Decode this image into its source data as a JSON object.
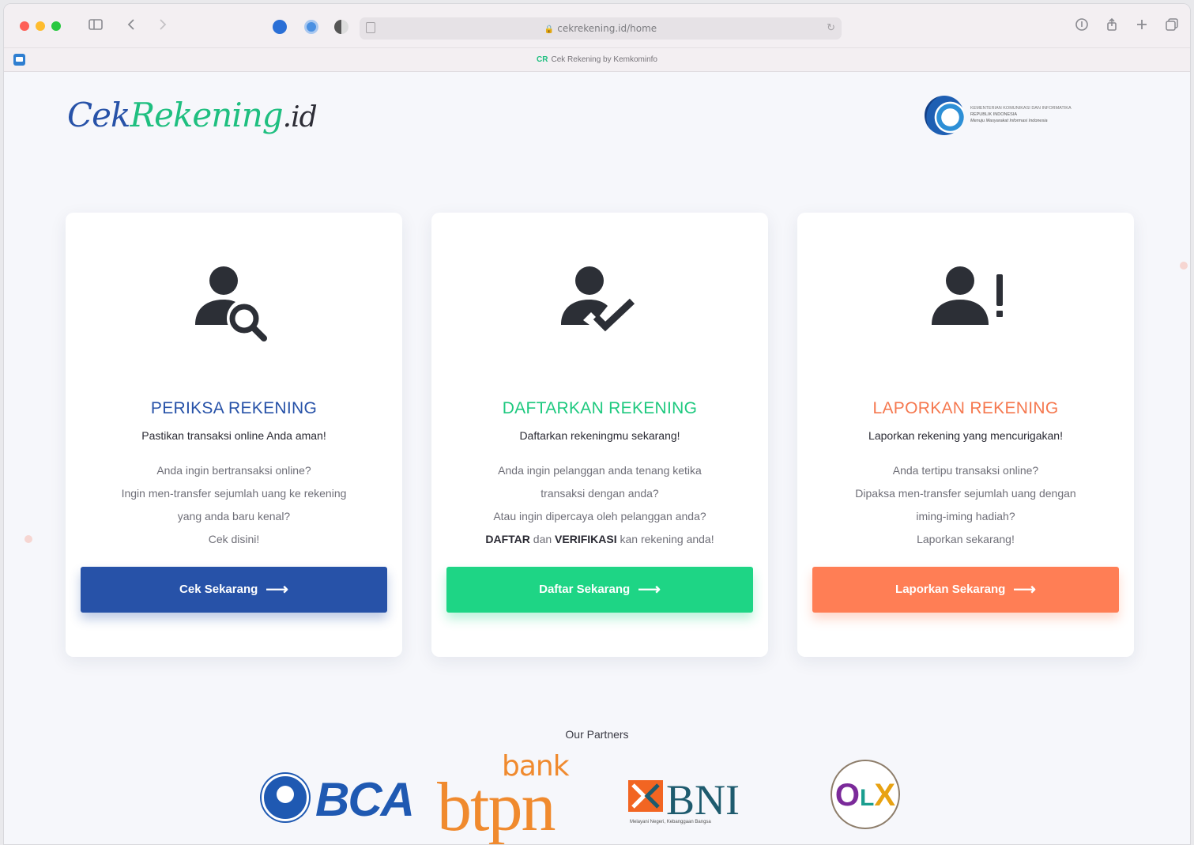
{
  "browser": {
    "url": "cekrekening.id/home",
    "tab_title": "Cek Rekening by Kemkominfo",
    "tab_favicon_text": "CR"
  },
  "header": {
    "logo_part1": "Cek",
    "logo_part2": "Rekening",
    "logo_part3": ".id",
    "ministry_line1": "KEMENTERIAN KOMUNIKASI DAN INFORMATIKA",
    "ministry_line2": "REPUBLIK INDONESIA",
    "ministry_line3": "Menuju Masyarakat Informasi Indonesia"
  },
  "cards": [
    {
      "title": "PERIKSA REKENING",
      "subtitle": "Pastikan transaksi online Anda aman!",
      "desc_lines": [
        "Anda ingin bertransaksi online?",
        "Ingin men-transfer sejumlah uang ke rekening",
        "yang anda baru kenal?",
        "Cek disini!"
      ],
      "button": "Cek Sekarang",
      "color": "#2752a8"
    },
    {
      "title": "DAFTARKAN REKENING",
      "subtitle": "Daftarkan rekeningmu sekarang!",
      "desc_lines": [
        "Anda ingin pelanggan anda tenang ketika",
        "transaksi dengan anda?",
        "Atau ingin dipercaya oleh pelanggan anda?"
      ],
      "desc_bold1": "DAFTAR",
      "desc_mid": " dan ",
      "desc_bold2": "VERIFIKASI",
      "desc_end": " kan rekening anda!",
      "button": "Daftar Sekarang",
      "color": "#1ed585"
    },
    {
      "title": "LAPORKAN REKENING",
      "subtitle": "Laporkan rekening yang mencurigakan!",
      "desc_lines": [
        "Anda tertipu transaksi online?",
        "Dipaksa men-transfer sejumlah uang dengan",
        "iming-iming hadiah?",
        "Laporkan sekarang!"
      ],
      "button": "Laporkan Sekarang",
      "color": "#ff7e55"
    }
  ],
  "partners": {
    "title": "Our Partners",
    "bca": "BCA",
    "btpn_small": "bank",
    "btpn": "btpn",
    "bni": "BNI",
    "bni_tag": "Melayani Negeri, Kebanggaan Bangsa",
    "olx_o": "O",
    "olx_l": "L",
    "olx_x": "X"
  }
}
